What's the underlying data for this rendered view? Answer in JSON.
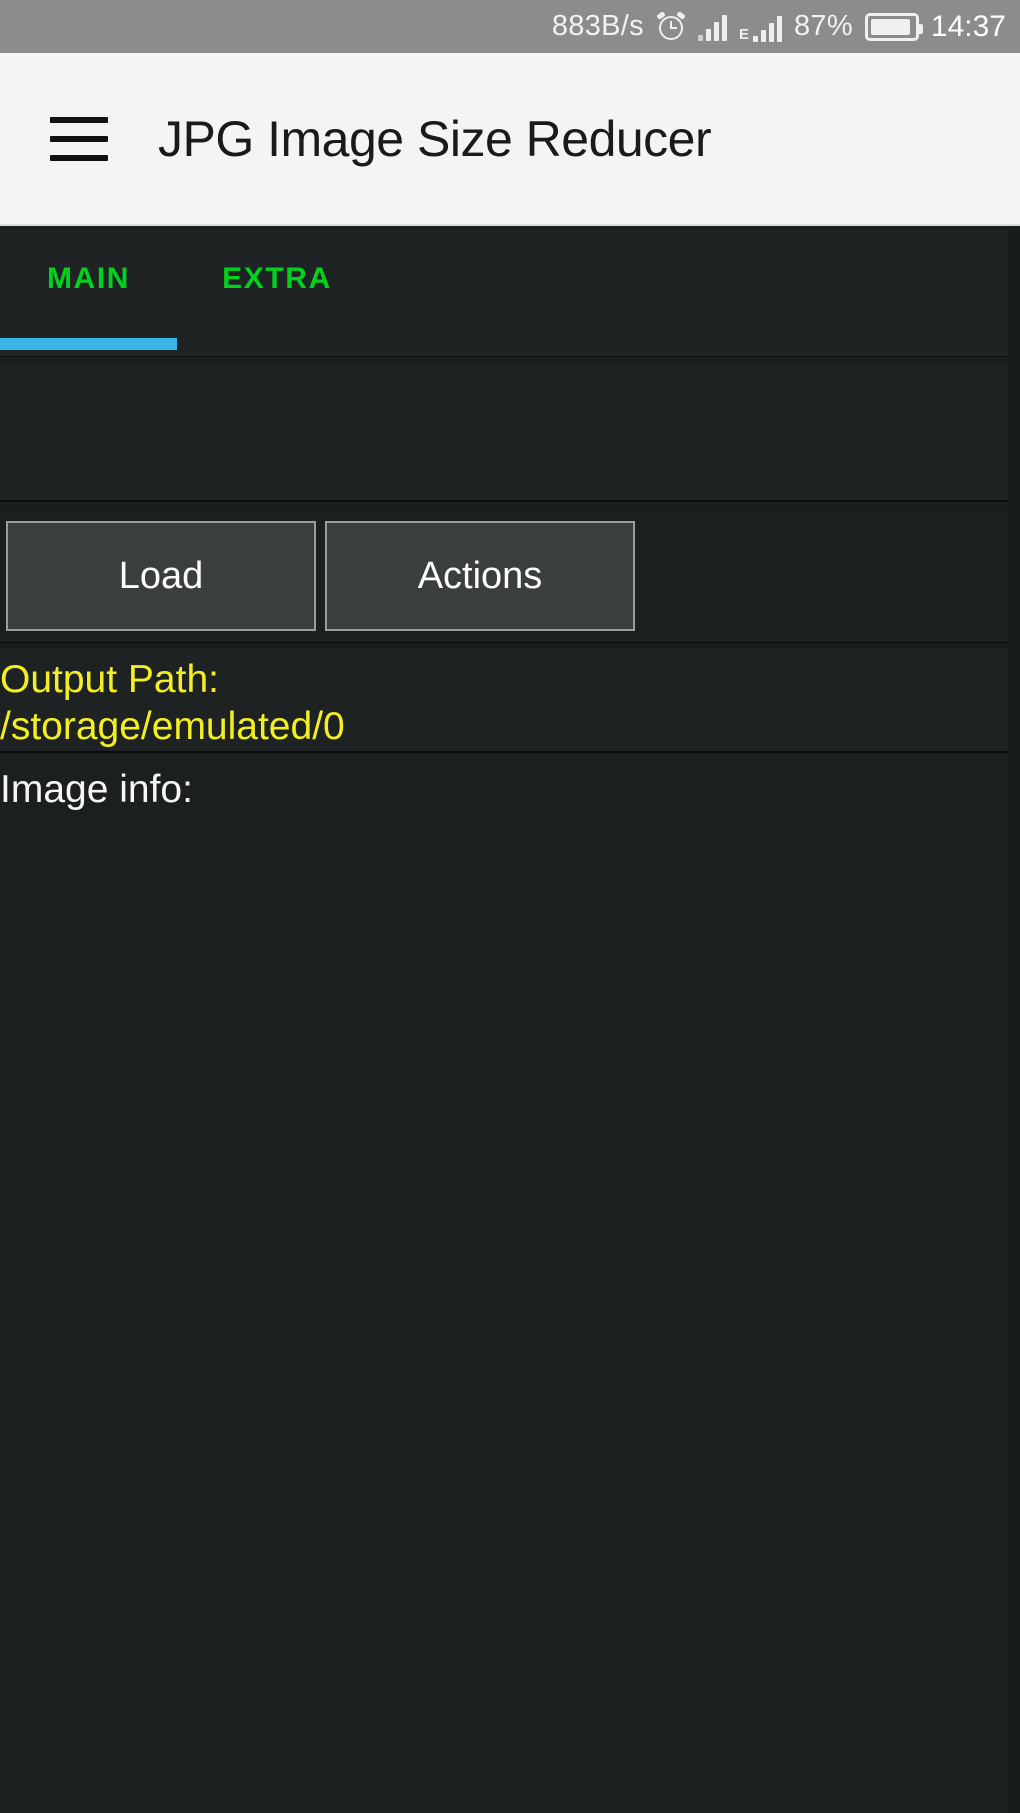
{
  "status_bar": {
    "network_speed": "883B/s",
    "alarm_icon": "alarm-clock-icon",
    "signal_icon": "signal-bars-icon",
    "data_network_letter": "E",
    "data_network_icon": "edge-data-signal-icon",
    "battery_percent": "87%",
    "battery_icon": "battery-icon",
    "time": "14:37",
    "background_color": "#8c8c8c",
    "text_color": "#f2f2f2"
  },
  "app_bar": {
    "menu_icon": "hamburger-menu-icon",
    "title": "JPG Image Size Reducer",
    "background_color": "#f4f4f4",
    "title_color": "#1a1a1a"
  },
  "tabs": {
    "items": [
      {
        "label": "MAIN",
        "selected": true
      },
      {
        "label": "EXTRA",
        "selected": false
      }
    ],
    "tab_text_color": "#00d21e",
    "indicator_color": "#39b7e8"
  },
  "banner": {
    "content": "",
    "background_color": "#1f2223"
  },
  "buttons": {
    "load_label": "Load",
    "actions_label": "Actions",
    "background_color": "#3b3e3f",
    "border_color": "#9a9d9e",
    "text_color": "#fdfdfd"
  },
  "output_path": {
    "label": "Output Path:",
    "value": "/storage/emulated/0",
    "text_color": "#f2ef23"
  },
  "image_info": {
    "label": "Image info:",
    "value": "",
    "text_color": "#f6f6f6"
  }
}
